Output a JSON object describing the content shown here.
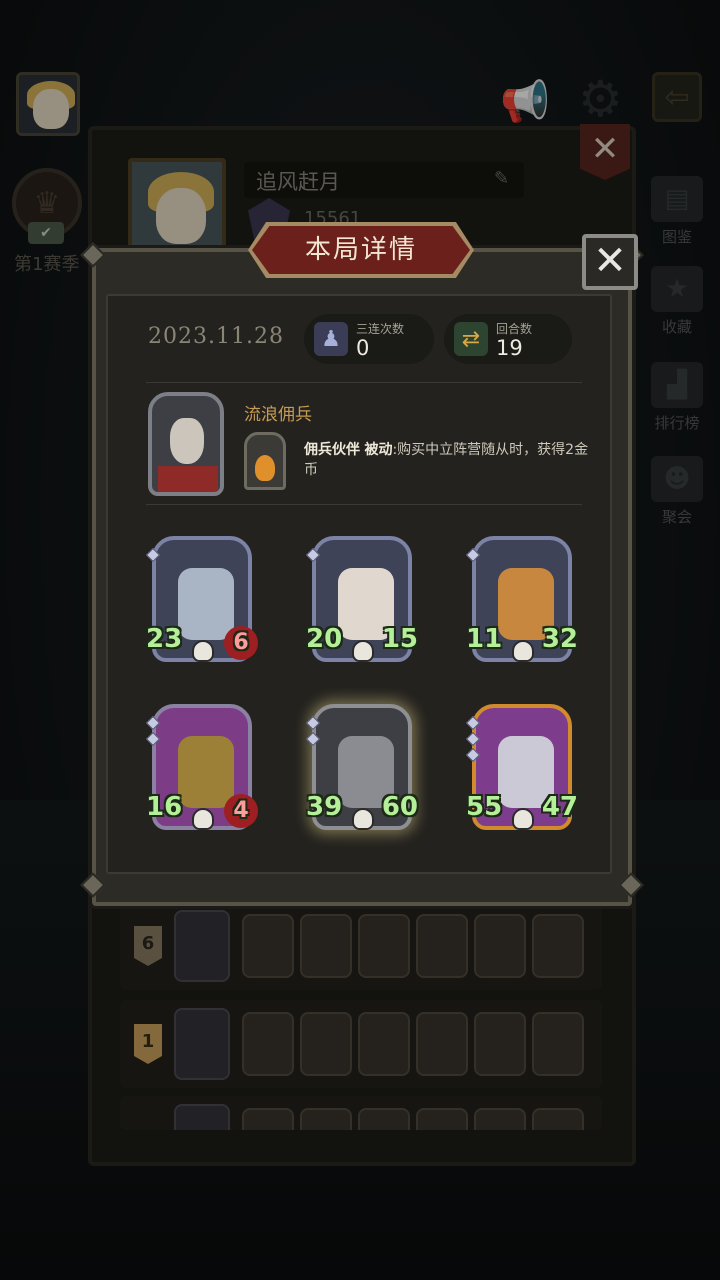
{
  "background": {
    "profile": {
      "name": "追风赶月",
      "score": "15561",
      "season_label": "第1赛季"
    },
    "side_menu": [
      {
        "label": "图鉴",
        "icon": "book-icon"
      },
      {
        "label": "收藏",
        "icon": "star-icon"
      },
      {
        "label": "排行榜",
        "icon": "podium-icon"
      },
      {
        "label": "聚会",
        "icon": "group-icon"
      }
    ],
    "games": [
      {
        "rank": "6",
        "rank_color": "#8a7c63"
      },
      {
        "rank": "1",
        "rank_color": "#caa15b"
      }
    ]
  },
  "modal": {
    "title": "本局详情",
    "close_glyph": "✕",
    "date": "2023.11.28",
    "stats": [
      {
        "label": "三连次数",
        "value": "0",
        "icon": "triple-icon"
      },
      {
        "label": "回合数",
        "value": "19",
        "icon": "rounds-icon"
      }
    ],
    "hero": {
      "name": "流浪佣兵",
      "skill_name": "佣兵伙伴",
      "skill_type": "被动",
      "skill_text": ":购买中立阵营随从时，获得2金币"
    },
    "units": [
      {
        "atk": "23",
        "hp": "6",
        "frame": "blue",
        "hp_style": "red",
        "body_color": "#a9b4c4"
      },
      {
        "atk": "20",
        "hp": "15",
        "frame": "blue",
        "hp_style": "green",
        "body_color": "#e0d8cf"
      },
      {
        "atk": "11",
        "hp": "32",
        "frame": "blue",
        "hp_style": "green",
        "body_color": "#c7873f"
      },
      {
        "atk": "16",
        "hp": "4",
        "frame": "purple",
        "hp_style": "red",
        "body_color": "#9c8038"
      },
      {
        "atk": "39",
        "hp": "60",
        "frame": "plain",
        "hp_style": "green",
        "body_color": "#8a8c92"
      },
      {
        "atk": "55",
        "hp": "47",
        "frame": "gold",
        "hp_style": "green",
        "body_color": "#cbc9d6"
      }
    ]
  }
}
